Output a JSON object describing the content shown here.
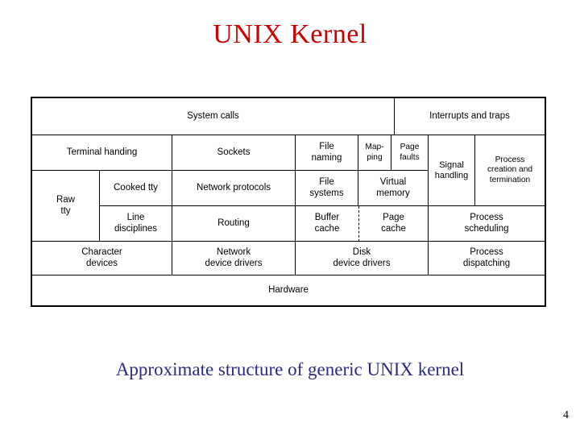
{
  "slide": {
    "title": "UNIX Kernel",
    "caption": "Approximate structure of generic UNIX kernel",
    "number": "4",
    "title_color": "#cc0000",
    "caption_color": "#2b2b80",
    "background_color": "#ffffff"
  },
  "diagram": {
    "name": "unix-kernel-layer-diagram",
    "rows": [
      {
        "label": "entry-points",
        "cells": [
          "System calls",
          "Interrupts and traps"
        ]
      },
      {
        "label": "upper-services",
        "cells": [
          "Terminal handing",
          "Sockets",
          "File naming",
          "Map-\nping",
          "Page\nfaults",
          "Signal\nhandling",
          "Process\ncreation and\ntermination"
        ]
      },
      {
        "label": "protocols-and-memory",
        "cells": [
          "Raw\ntty",
          "Cooked tty",
          "Network protocols",
          "File\nsystems",
          "Virtual\nmemory"
        ]
      },
      {
        "label": "caches-and-scheduling",
        "cells": [
          "Line\ndisciplines",
          "Routing",
          "Buffer\ncache",
          "Page\ncache",
          "Process\nscheduling"
        ]
      },
      {
        "label": "device-drivers",
        "cells": [
          "Character\ndevices",
          "Network\ndevice drivers",
          "Disk\ndevice drivers",
          "Process\ndispatching"
        ]
      },
      {
        "label": "hardware",
        "cells": [
          "Hardware"
        ]
      }
    ],
    "cells": {
      "system_calls": "System calls",
      "interrupts_and_traps": "Interrupts and traps",
      "terminal_handing": "Terminal handing",
      "sockets": "Sockets",
      "file_naming_l1": "File",
      "file_naming_l2": "naming",
      "mapping_l1": "Map-",
      "mapping_l2": "ping",
      "page_faults_l1": "Page",
      "page_faults_l2": "faults",
      "signal_handling_l1": "Signal",
      "signal_handling_l2": "handling",
      "process_creation_l1": "Process",
      "process_creation_l2": "creation and",
      "process_creation_l3": "termination",
      "raw_tty_l1": "Raw",
      "raw_tty_l2": "tty",
      "cooked_tty": "Cooked tty",
      "network_protocols": "Network protocols",
      "file_systems_l1": "File",
      "file_systems_l2": "systems",
      "virtual_memory_l1": "Virtual",
      "virtual_memory_l2": "memory",
      "line_disciplines_l1": "Line",
      "line_disciplines_l2": "disciplines",
      "routing": "Routing",
      "buffer_cache_l1": "Buffer",
      "buffer_cache_l2": "cache",
      "page_cache_l1": "Page",
      "page_cache_l2": "cache",
      "process_scheduling_l1": "Process",
      "process_scheduling_l2": "scheduling",
      "character_devices_l1": "Character",
      "character_devices_l2": "devices",
      "network_device_drivers_l1": "Network",
      "network_device_drivers_l2": "device drivers",
      "disk_device_drivers_l1": "Disk",
      "disk_device_drivers_l2": "device drivers",
      "process_dispatching_l1": "Process",
      "process_dispatching_l2": "dispatching",
      "hardware": "Hardware"
    }
  }
}
